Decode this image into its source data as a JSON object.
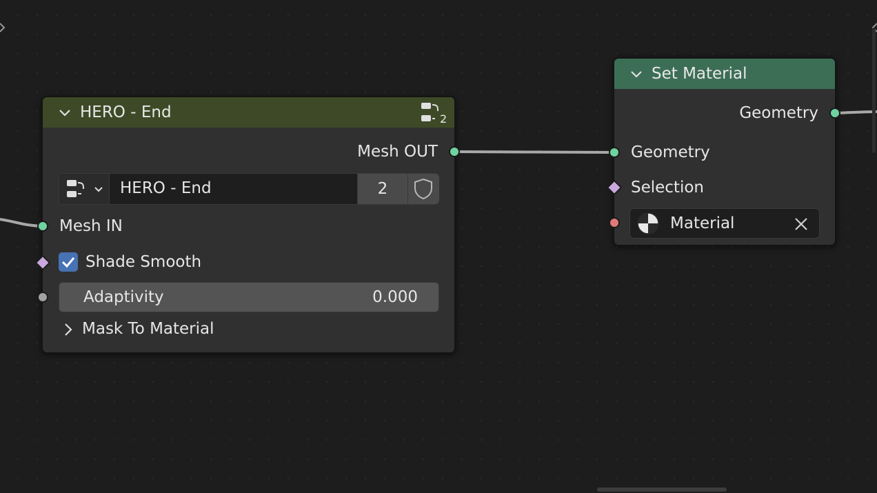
{
  "nodes": {
    "hero": {
      "title": "HERO - End",
      "user_count": "2",
      "header_color": "#3e4a27",
      "output_label": "Mesh OUT",
      "datablock_name": "HERO - End",
      "datablock_users": "2",
      "input_mesh_label": "Mesh IN",
      "shade_smooth_label": "Shade Smooth",
      "shade_smooth_checked": true,
      "adaptivity_label": "Adaptivity",
      "adaptivity_value": "0.000",
      "panel_label": "Mask To Material"
    },
    "set_material": {
      "title": "Set Material",
      "header_color": "#3c6e56",
      "output_label": "Geometry",
      "input_geometry_label": "Geometry",
      "input_selection_label": "Selection",
      "material_value": "Material"
    }
  },
  "socket_colors": {
    "geometry": "#6fd3a0",
    "boolean": "#c9a8e0",
    "float": "#a1a1a1",
    "material": "#e07a7a"
  },
  "icons": {
    "node_group": "node-tree-icon",
    "fake_user": "shield-icon",
    "collapse": "chevron-down-icon",
    "panel": "chevron-right-icon",
    "material": "material-ball-icon",
    "clear": "close-icon"
  }
}
